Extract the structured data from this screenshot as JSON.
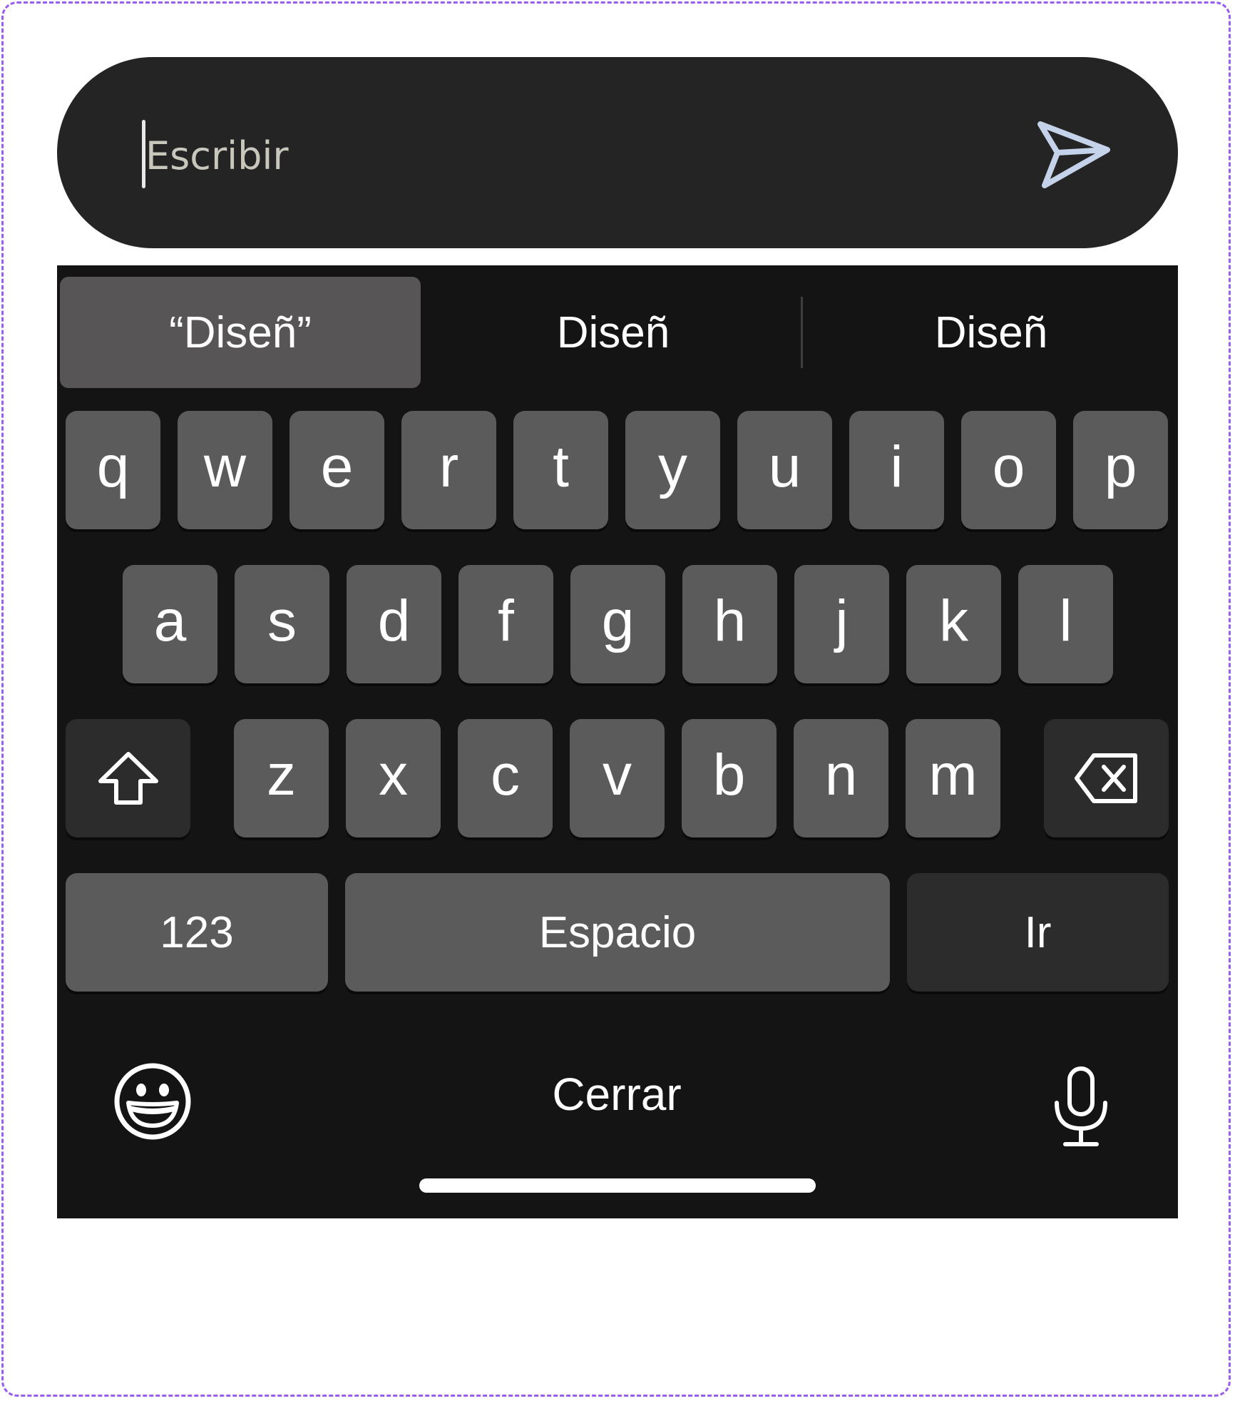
{
  "compose": {
    "placeholder": "Escribir",
    "value": "",
    "send_icon": "send-icon"
  },
  "suggestions": [
    {
      "label": "“Diseñ”",
      "highlighted": true
    },
    {
      "label": "Diseñ",
      "highlighted": false
    },
    {
      "label": "Diseñ",
      "highlighted": false
    }
  ],
  "keyboard": {
    "row1": [
      "q",
      "w",
      "e",
      "r",
      "t",
      "y",
      "u",
      "i",
      "o",
      "p"
    ],
    "row2": [
      "a",
      "s",
      "d",
      "f",
      "g",
      "h",
      "j",
      "k",
      "l"
    ],
    "row3": [
      "z",
      "x",
      "c",
      "v",
      "b",
      "n",
      "m"
    ],
    "shift_icon": "shift-icon",
    "backspace_icon": "backspace-icon",
    "numbers_label": "123",
    "space_label": "Espacio",
    "go_label": "Ir",
    "emoji_icon": "emoji-icon",
    "close_label": "Cerrar",
    "mic_icon": "microphone-icon"
  },
  "colors": {
    "compose_bg": "#242424",
    "keyboard_bg": "#141414",
    "key_bg": "#5b5b5b",
    "special_key_bg": "#2c2c2c",
    "send_icon": "#c4d2ea",
    "frame_border": "#9b5cf0"
  }
}
